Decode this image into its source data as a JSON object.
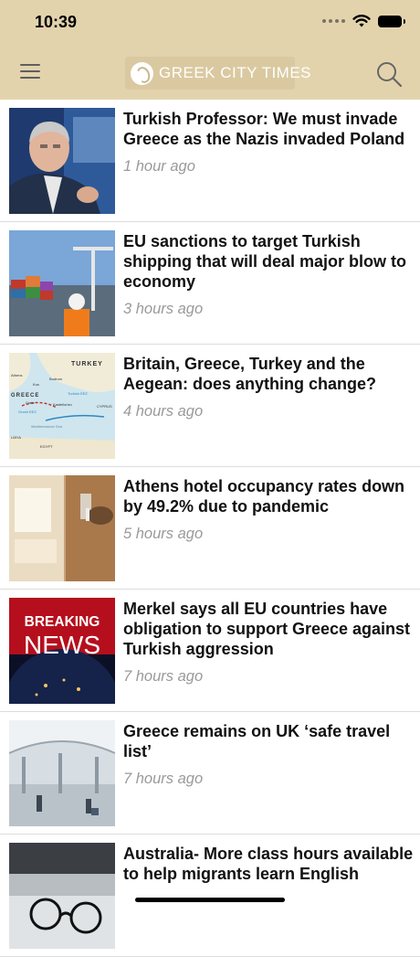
{
  "status": {
    "time": "10:39"
  },
  "header": {
    "logo_text": "GREEK CITY TIMES",
    "menu_icon": "hamburger-icon",
    "search_icon": "search-icon"
  },
  "articles": [
    {
      "title": "Turkish Professor: We must invade Greece as the Nazis invaded Poland",
      "time": "1 hour ago",
      "thumb": "man-tv-interview"
    },
    {
      "title": "EU sanctions to target Turkish shipping that will deal major blow to economy",
      "time": "3 hours ago",
      "thumb": "shipping-containers"
    },
    {
      "title": "Britain, Greece, Turkey and the Aegean: does anything change?",
      "time": "4 hours ago",
      "thumb": "aegean-map",
      "thumb_text": [
        "TURKEY",
        "GREECE",
        "Athens",
        "Bodrum",
        "Kos",
        "Crete",
        "Kastellorizo",
        "Turkish EEZ",
        "Greek EEZ",
        "Mediterranean Sea",
        "CYPRUS",
        "LIBYA",
        "EGYPT"
      ]
    },
    {
      "title": "Athens hotel occupancy rates down by 49.2% due to pandemic",
      "time": "5 hours ago",
      "thumb": "hotel-room"
    },
    {
      "title": "Merkel says all EU countries have obligation to support Greece against Turkish aggression",
      "time": "7 hours ago",
      "thumb": "breaking-news",
      "thumb_text": [
        "BREAKING",
        "NEWS"
      ]
    },
    {
      "title": "Greece remains on UK ‘safe travel list’",
      "time": "7 hours ago",
      "thumb": "airport-terminal"
    },
    {
      "title": "Australia- More class hours available to help migrants learn English",
      "time": "",
      "thumb": "laptop-glasses"
    }
  ]
}
